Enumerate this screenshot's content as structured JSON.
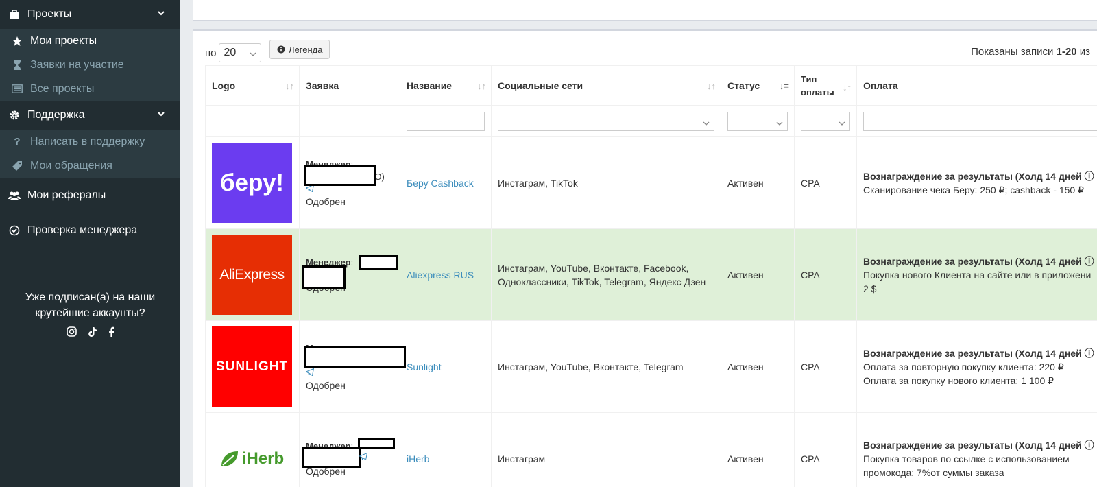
{
  "sidebar": {
    "projects_title": "Проекты",
    "projects_items": [
      "Мои проекты",
      "Заявки на участие",
      "Все проекты"
    ],
    "support_title": "Поддержка",
    "support_items": [
      "Написать в поддержку",
      "Мои обращения"
    ],
    "referrals": "Мои рефералы",
    "manager_check": "Проверка менеджера",
    "promo_line1": "Уже подписан(а) на наши",
    "promo_line2": "крутейшие аккаунты?"
  },
  "toolbar": {
    "per_label": "по",
    "per_value": "20",
    "legend_label": "Легенда",
    "shown_prefix": "Показаны записи ",
    "shown_range": "1-20",
    "shown_suffix": " из"
  },
  "table": {
    "headers": {
      "logo": "Logo",
      "request": "Заявка",
      "name": "Название",
      "social": "Социальные сети",
      "status": "Статус",
      "pay_type_1": "Тип",
      "pay_type_2": "оплаты",
      "payment": "Оплата"
    },
    "manager_label": "Менеджер",
    "rows": [
      {
        "logo_text": "беру!",
        "logo_bg": "#6b3cf0",
        "manager_suffix": "(О)",
        "approval": "Одобрен",
        "name": "Беру Cashback",
        "social": "Инстаграм, TikTok",
        "status": "Активен",
        "pay_type": "CPA",
        "pay_title": "Вознаграждение за результаты (Холд 14 дней",
        "pay_lines": [
          "Сканирование чека Беру: 250 ₽; cashback - 150 ₽"
        ]
      },
      {
        "logo_text": "AliExpress",
        "logo_bg": "#e62e04",
        "manager_suffix": "",
        "approval": "Одобрен",
        "name": "Aliexpress RUS",
        "social_1": "Инстаграм, YouTube, Вконтакте, Facebook,",
        "social_2": "Одноклассники, TikTok, Telegram, Яндекс Дзен",
        "status": "Активен",
        "pay_type": "CPA",
        "pay_title": "Вознаграждение за результаты (Холд 14 дней",
        "pay_lines": [
          "Покупка нового Клиента на сайте или в приложени",
          "2 $"
        ]
      },
      {
        "logo_text": "SUNLIGHT",
        "logo_bg": "#ff0000",
        "manager_suffix": "",
        "approval": "Одобрен",
        "name": "Sunlight",
        "social": "Инстаграм, YouTube, Вконтакте, Telegram",
        "status": "Активен",
        "pay_type": "CPA",
        "pay_title": "Вознаграждение за результаты (Холд 14 дней",
        "pay_lines": [
          "Оплата за повторную покупку клиента: 220 ₽",
          "Оплата за покупку нового клиента: 1 100 ₽"
        ]
      },
      {
        "logo_text": "iHerb",
        "logo_bg": "#ffffff",
        "manager_suffix": "",
        "approval": "Одобрен",
        "name": "iHerb",
        "social": "Инстаграм",
        "status": "Активен",
        "pay_type": "CPA",
        "pay_title": "Вознаграждение за результаты (Холд 14 дней",
        "pay_lines": [
          "Покупка товаров по ссылке с использованием",
          "промокода: 7%от суммы заказа"
        ]
      }
    ]
  },
  "colors": {
    "sidebar_bg": "#222d32",
    "sidebar_sub_bg": "#2c3b41",
    "link": "#3c8dbc",
    "highlight_row": "#dff0d8",
    "iherb_green": "#459a2c"
  }
}
